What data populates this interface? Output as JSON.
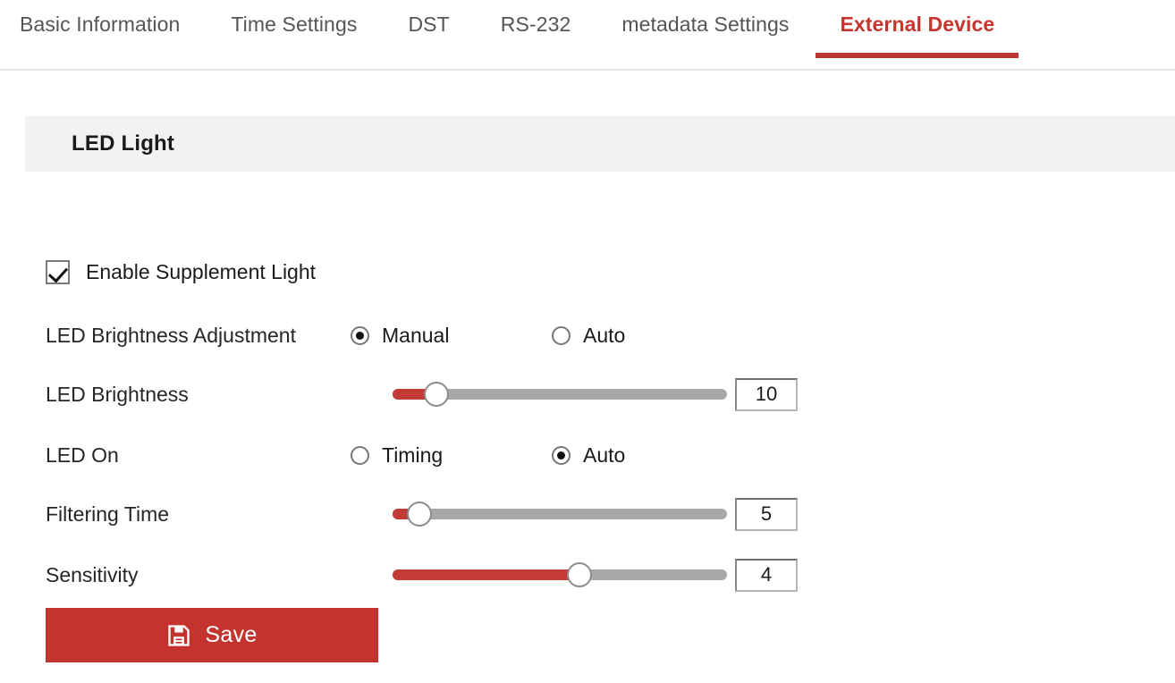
{
  "tabs": [
    {
      "label": "Basic Information",
      "active": false
    },
    {
      "label": "Time Settings",
      "active": false
    },
    {
      "label": "DST",
      "active": false
    },
    {
      "label": "RS-232",
      "active": false
    },
    {
      "label": "metadata Settings",
      "active": false
    },
    {
      "label": "External Device",
      "active": true
    }
  ],
  "panel": {
    "title": "LED Light"
  },
  "enable_supplement_light": {
    "label": "Enable Supplement Light",
    "checked": true
  },
  "brightness_adjustment": {
    "label": "LED Brightness Adjustment",
    "options": [
      {
        "label": "Manual",
        "selected": true
      },
      {
        "label": "Auto",
        "selected": false
      }
    ]
  },
  "led_brightness": {
    "label": "LED Brightness",
    "value": "10",
    "percent": 13
  },
  "led_on": {
    "label": "LED On",
    "options": [
      {
        "label": "Timing",
        "selected": false
      },
      {
        "label": "Auto",
        "selected": true
      }
    ]
  },
  "filtering_time": {
    "label": "Filtering Time",
    "value": "5",
    "percent": 8
  },
  "sensitivity": {
    "label": "Sensitivity",
    "value": "4",
    "percent": 56
  },
  "save_button": {
    "label": "Save",
    "icon": "floppy-disk-save-icon"
  },
  "colors": {
    "accent_red": "#c4342f",
    "tab_active_red": "#c8352f",
    "slider_fill": "#c43a35",
    "slider_track": "#a8a8a8",
    "panel_bg": "#f2f2f2"
  }
}
